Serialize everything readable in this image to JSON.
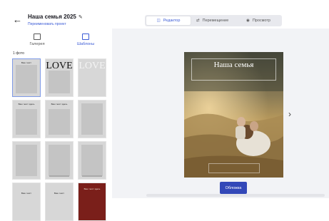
{
  "header": {
    "back_icon": "arrow-left-icon",
    "title": "Наша семья 2025",
    "edit_icon": "pencil-icon",
    "rename_link": "Переименовать проект"
  },
  "modes": [
    {
      "label": "Редактор",
      "icon": "editor-icon",
      "active": true
    },
    {
      "label": "Перемещение",
      "icon": "move-icon",
      "active": false
    },
    {
      "label": "Просмотр",
      "icon": "eye-icon",
      "active": false
    }
  ],
  "left_tabs": [
    {
      "label": "Галерея",
      "icon": "gallery-icon",
      "active": false
    },
    {
      "label": "Шаблоны",
      "icon": "templates-icon",
      "active": true
    }
  ],
  "photo_count": "1 фото",
  "templates": [
    {
      "kind": "caption",
      "text": "Ваш текст",
      "selected": true
    },
    {
      "kind": "love",
      "text": "LOVE"
    },
    {
      "kind": "love-light",
      "text": "LOVE"
    },
    {
      "kind": "caption",
      "text": "Ваш текст здесь"
    },
    {
      "kind": "caption",
      "text": "Ваш текст здесь"
    },
    {
      "kind": "plain",
      "text": ""
    },
    {
      "kind": "plain",
      "text": ""
    },
    {
      "kind": "plain",
      "text": ""
    },
    {
      "kind": "plain",
      "text": ""
    },
    {
      "kind": "caption-bottom",
      "text": "Ваш текст"
    },
    {
      "kind": "caption-bottom",
      "text": "Ваш текст"
    },
    {
      "kind": "dark",
      "text": "Ваш текст здесь"
    }
  ],
  "cover": {
    "heading": "Наша семья",
    "bottom_caption": ""
  },
  "next_icon": "chevron-right-icon",
  "cover_button": "Обложка",
  "colors": {
    "accent": "#3b5bd6",
    "button": "#3348b8"
  }
}
